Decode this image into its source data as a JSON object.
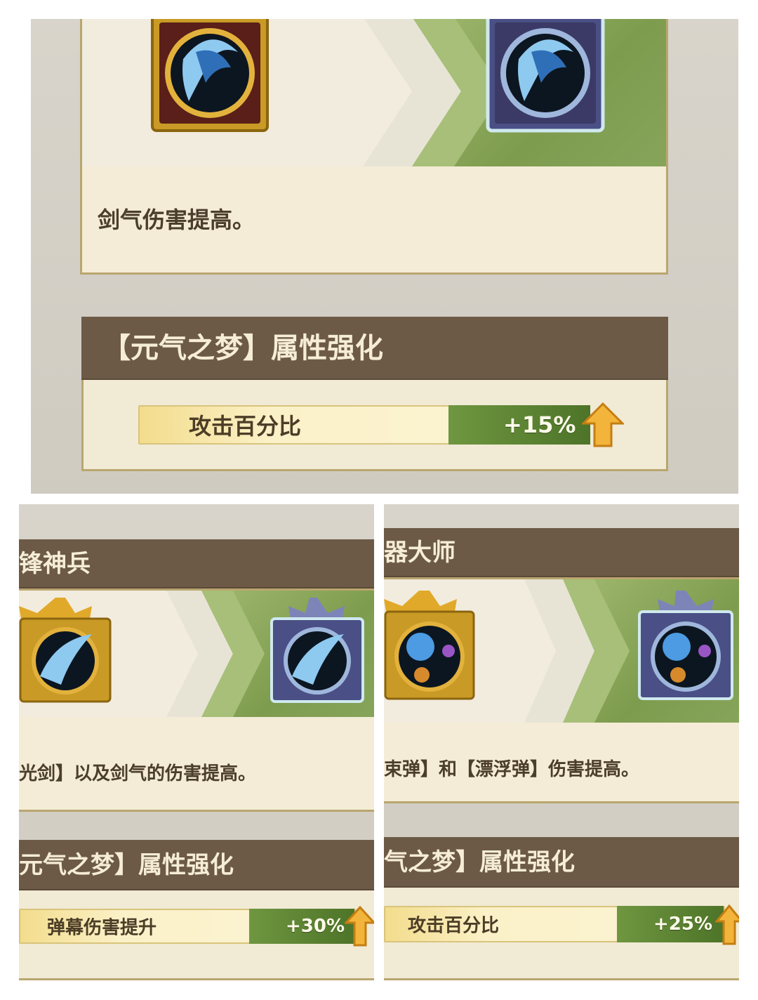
{
  "panels": {
    "a": {
      "description": "剑气伤害提高。",
      "enhance_title": "【元气之梦】属性强化",
      "stat_label": "攻击百分比",
      "stat_value": "+15%"
    },
    "b": {
      "title_partial": "锋神兵",
      "description": "光剑】以及剑气的伤害提高。",
      "enhance_title": "元气之梦】属性强化",
      "stat_label": "弹幕伤害提升",
      "stat_value": "+30%"
    },
    "c": {
      "title_partial": "器大师",
      "description": "束弹】和【漂浮弹】伤害提高。",
      "enhance_title": "气之梦】属性强化",
      "stat_label": "攻击百分比",
      "stat_value": "+25%"
    }
  },
  "icons": {
    "before": "gold-frame-skill-icon",
    "after": "prismatic-frame-skill-icon",
    "upgrade_arrow": "up-arrow-icon"
  },
  "colors": {
    "title_bar": "#6c5a47",
    "value_green": "#5a8232",
    "card_bg": "#f4ecd6",
    "gold_frame": "#c99a25"
  }
}
